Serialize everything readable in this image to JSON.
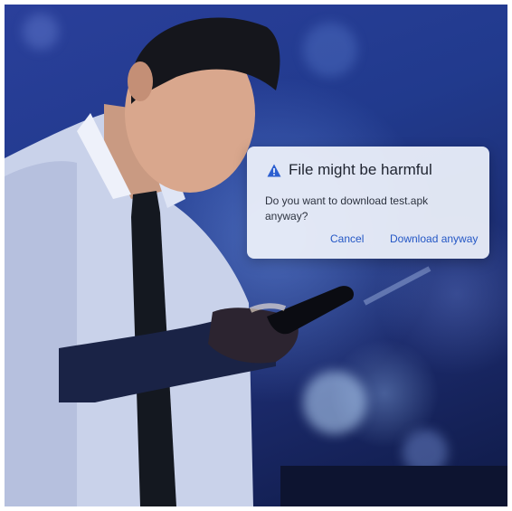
{
  "dialog": {
    "title": "File might be harmful",
    "message": "Do you want to download test.apk anyway?",
    "cancel_label": "Cancel",
    "download_label": "Download anyway",
    "icon": "warning-triangle-icon"
  },
  "colors": {
    "background_blue": "#213a8d",
    "button_text": "#2457c5",
    "warning_icon": "#2c5fd0"
  }
}
